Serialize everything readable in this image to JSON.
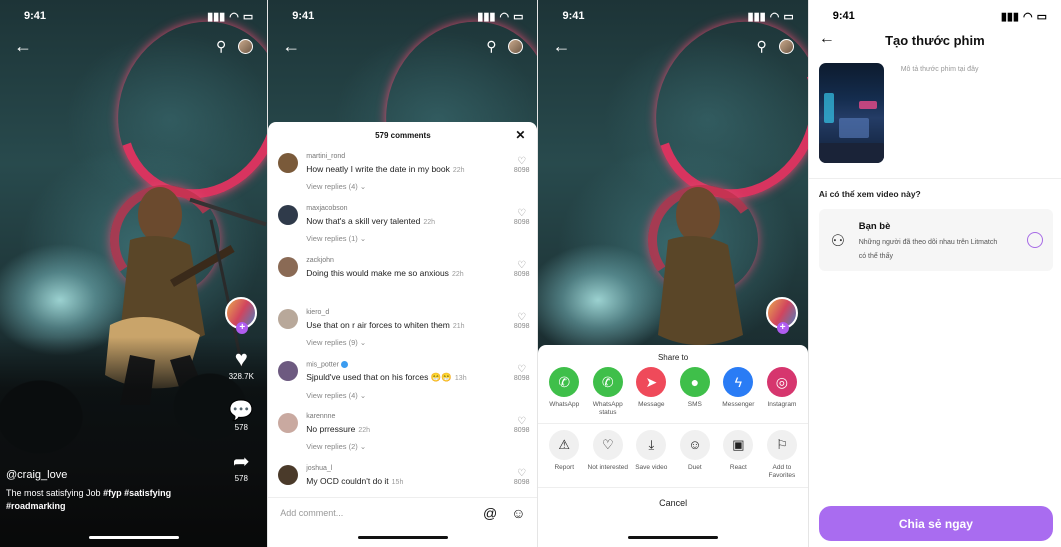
{
  "status": {
    "time": "9:41"
  },
  "video": {
    "handle": "@craig_love",
    "caption": "The most satisfying Job",
    "tags": "#fyp #satisfying",
    "tag2": "#roadmarking",
    "likes": "328.7K",
    "comments": "578",
    "shares": "578"
  },
  "comments": {
    "count": "579 comments",
    "placeholder": "Add comment...",
    "items": [
      {
        "user": "martini_rond",
        "text": "How neatly I write the date in my book",
        "time": "22h",
        "replies": "View replies (4)",
        "likes": "8098",
        "color": "#7a5a3a"
      },
      {
        "user": "maxjacobson",
        "text": "Now that's a skill very talented",
        "time": "22h",
        "replies": "View replies (1)",
        "likes": "8098",
        "color": "#2f3a4a"
      },
      {
        "user": "zackjohn",
        "text": "Doing this would make me so anxious",
        "time": "22h",
        "replies": "",
        "likes": "8098",
        "color": "#8a6a55"
      },
      {
        "user": "kiero_d",
        "text": "Use that on r air forces to whiten them",
        "time": "21h",
        "replies": "View replies (9)",
        "likes": "8098",
        "color": "#b8a89a"
      },
      {
        "user": "mis_potter",
        "text": "Sjpuld've used that on his forces 😁😁",
        "time": "13h",
        "replies": "View replies (4)",
        "likes": "8098",
        "color": "#6d5a80"
      },
      {
        "user": "karennne",
        "text": "No prressure",
        "time": "22h",
        "replies": "View replies (2)",
        "likes": "8098",
        "color": "#c9a9a0"
      },
      {
        "user": "joshua_l",
        "text": "My OCD couldn't do it",
        "time": "15h",
        "replies": "",
        "likes": "8098",
        "color": "#4a3a2a"
      }
    ]
  },
  "share": {
    "title": "Share to",
    "cancel": "Cancel",
    "apps": [
      {
        "label": "WhatsApp",
        "color": "#3fbf4a",
        "glyph": "✆"
      },
      {
        "label": "WhatsApp status",
        "color": "#3fbf4a",
        "glyph": "✆"
      },
      {
        "label": "Message",
        "color": "#ef4a5a",
        "glyph": "➤"
      },
      {
        "label": "SMS",
        "color": "#3fbf4a",
        "glyph": "●"
      },
      {
        "label": "Messenger",
        "color": "#2a7cf5",
        "glyph": "ϟ"
      },
      {
        "label": "Instagram",
        "color": "#d6366e",
        "glyph": "◎"
      }
    ],
    "actions": [
      {
        "label": "Report",
        "glyph": "⚠"
      },
      {
        "label": "Not interested",
        "glyph": "♡"
      },
      {
        "label": "Save video",
        "glyph": "⤓"
      },
      {
        "label": "Duet",
        "glyph": "☺"
      },
      {
        "label": "React",
        "glyph": "▣"
      },
      {
        "label": "Add to Favorites",
        "glyph": "⚐"
      }
    ]
  },
  "create": {
    "title": "Tạo thước phim",
    "desc_placeholder": "Mô tả thước phim tại đây",
    "who": "Ai có thể xem video này?",
    "option_title": "Bạn bè",
    "option_desc": "Những người đã theo dõi nhau trên Litmatch có thể thấy",
    "cta": "Chia sẻ ngay"
  }
}
